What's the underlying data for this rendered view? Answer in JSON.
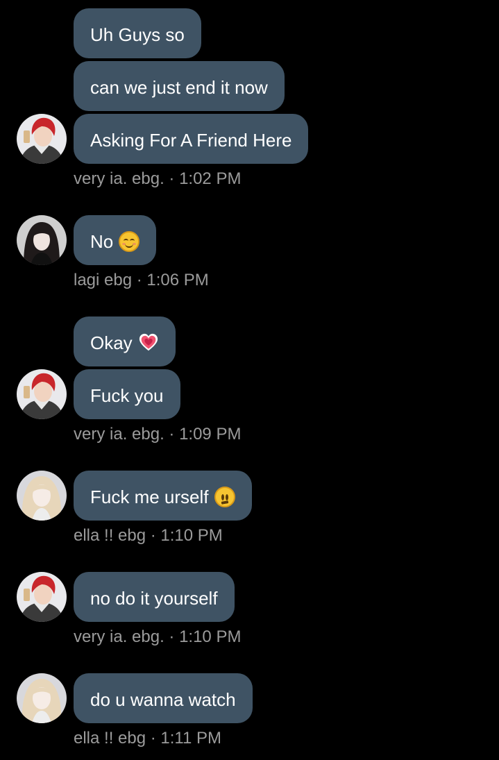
{
  "messages": [
    {
      "text": "Uh Guys so"
    },
    {
      "text": "can we just end it now"
    },
    {
      "text": "Asking For A Friend Here"
    },
    {
      "text": "No"
    },
    {
      "text": "Okay"
    },
    {
      "text": "Fuck you"
    },
    {
      "text": "Fuck me urself"
    },
    {
      "text": "no do it yourself"
    },
    {
      "text": "do u wanna watch"
    }
  ],
  "meta": [
    {
      "sender": "very ia. ebg.",
      "time": "1:02 PM",
      "line": "very ia. ebg. · 1:02 PM"
    },
    {
      "sender": "lagi ebg",
      "time": "1:06 PM",
      "line": "lagi ebg · 1:06 PM"
    },
    {
      "sender": "very ia. ebg.",
      "time": "1:09 PM",
      "line": "very ia. ebg. · 1:09 PM"
    },
    {
      "sender": "ella !! ebg",
      "time": "1:10 PM",
      "line": "ella !! ebg · 1:10 PM"
    },
    {
      "sender": "very ia. ebg.",
      "time": "1:10 PM",
      "line": "very ia. ebg. · 1:10 PM"
    },
    {
      "sender": "ella !! ebg",
      "time": "1:11 PM",
      "line": "ella !! ebg · 1:11 PM"
    }
  ],
  "emojis": {
    "smile": "smiling-face-emoji",
    "heart": "heart-emoji",
    "neutral": "neutral-face-emoji"
  },
  "colors": {
    "background": "#000000",
    "bubble": "#3f5364",
    "text": "#ffffff",
    "meta": "#9b9b9b"
  }
}
